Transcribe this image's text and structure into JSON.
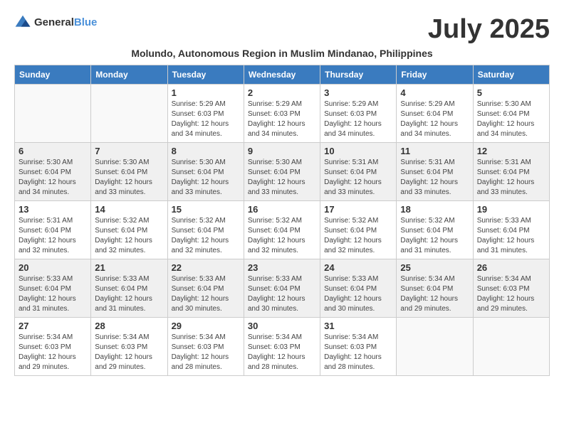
{
  "header": {
    "logo_general": "General",
    "logo_blue": "Blue",
    "month_title": "July 2025",
    "subtitle": "Molundo, Autonomous Region in Muslim Mindanao, Philippines"
  },
  "days_of_week": [
    "Sunday",
    "Monday",
    "Tuesday",
    "Wednesday",
    "Thursday",
    "Friday",
    "Saturday"
  ],
  "weeks": [
    {
      "shaded": false,
      "days": [
        {
          "number": "",
          "info": ""
        },
        {
          "number": "",
          "info": ""
        },
        {
          "number": "1",
          "info": "Sunrise: 5:29 AM\nSunset: 6:03 PM\nDaylight: 12 hours and 34 minutes."
        },
        {
          "number": "2",
          "info": "Sunrise: 5:29 AM\nSunset: 6:03 PM\nDaylight: 12 hours and 34 minutes."
        },
        {
          "number": "3",
          "info": "Sunrise: 5:29 AM\nSunset: 6:03 PM\nDaylight: 12 hours and 34 minutes."
        },
        {
          "number": "4",
          "info": "Sunrise: 5:29 AM\nSunset: 6:04 PM\nDaylight: 12 hours and 34 minutes."
        },
        {
          "number": "5",
          "info": "Sunrise: 5:30 AM\nSunset: 6:04 PM\nDaylight: 12 hours and 34 minutes."
        }
      ]
    },
    {
      "shaded": true,
      "days": [
        {
          "number": "6",
          "info": "Sunrise: 5:30 AM\nSunset: 6:04 PM\nDaylight: 12 hours and 34 minutes."
        },
        {
          "number": "7",
          "info": "Sunrise: 5:30 AM\nSunset: 6:04 PM\nDaylight: 12 hours and 33 minutes."
        },
        {
          "number": "8",
          "info": "Sunrise: 5:30 AM\nSunset: 6:04 PM\nDaylight: 12 hours and 33 minutes."
        },
        {
          "number": "9",
          "info": "Sunrise: 5:30 AM\nSunset: 6:04 PM\nDaylight: 12 hours and 33 minutes."
        },
        {
          "number": "10",
          "info": "Sunrise: 5:31 AM\nSunset: 6:04 PM\nDaylight: 12 hours and 33 minutes."
        },
        {
          "number": "11",
          "info": "Sunrise: 5:31 AM\nSunset: 6:04 PM\nDaylight: 12 hours and 33 minutes."
        },
        {
          "number": "12",
          "info": "Sunrise: 5:31 AM\nSunset: 6:04 PM\nDaylight: 12 hours and 33 minutes."
        }
      ]
    },
    {
      "shaded": false,
      "days": [
        {
          "number": "13",
          "info": "Sunrise: 5:31 AM\nSunset: 6:04 PM\nDaylight: 12 hours and 32 minutes."
        },
        {
          "number": "14",
          "info": "Sunrise: 5:32 AM\nSunset: 6:04 PM\nDaylight: 12 hours and 32 minutes."
        },
        {
          "number": "15",
          "info": "Sunrise: 5:32 AM\nSunset: 6:04 PM\nDaylight: 12 hours and 32 minutes."
        },
        {
          "number": "16",
          "info": "Sunrise: 5:32 AM\nSunset: 6:04 PM\nDaylight: 12 hours and 32 minutes."
        },
        {
          "number": "17",
          "info": "Sunrise: 5:32 AM\nSunset: 6:04 PM\nDaylight: 12 hours and 32 minutes."
        },
        {
          "number": "18",
          "info": "Sunrise: 5:32 AM\nSunset: 6:04 PM\nDaylight: 12 hours and 31 minutes."
        },
        {
          "number": "19",
          "info": "Sunrise: 5:33 AM\nSunset: 6:04 PM\nDaylight: 12 hours and 31 minutes."
        }
      ]
    },
    {
      "shaded": true,
      "days": [
        {
          "number": "20",
          "info": "Sunrise: 5:33 AM\nSunset: 6:04 PM\nDaylight: 12 hours and 31 minutes."
        },
        {
          "number": "21",
          "info": "Sunrise: 5:33 AM\nSunset: 6:04 PM\nDaylight: 12 hours and 31 minutes."
        },
        {
          "number": "22",
          "info": "Sunrise: 5:33 AM\nSunset: 6:04 PM\nDaylight: 12 hours and 30 minutes."
        },
        {
          "number": "23",
          "info": "Sunrise: 5:33 AM\nSunset: 6:04 PM\nDaylight: 12 hours and 30 minutes."
        },
        {
          "number": "24",
          "info": "Sunrise: 5:33 AM\nSunset: 6:04 PM\nDaylight: 12 hours and 30 minutes."
        },
        {
          "number": "25",
          "info": "Sunrise: 5:34 AM\nSunset: 6:04 PM\nDaylight: 12 hours and 29 minutes."
        },
        {
          "number": "26",
          "info": "Sunrise: 5:34 AM\nSunset: 6:03 PM\nDaylight: 12 hours and 29 minutes."
        }
      ]
    },
    {
      "shaded": false,
      "days": [
        {
          "number": "27",
          "info": "Sunrise: 5:34 AM\nSunset: 6:03 PM\nDaylight: 12 hours and 29 minutes."
        },
        {
          "number": "28",
          "info": "Sunrise: 5:34 AM\nSunset: 6:03 PM\nDaylight: 12 hours and 29 minutes."
        },
        {
          "number": "29",
          "info": "Sunrise: 5:34 AM\nSunset: 6:03 PM\nDaylight: 12 hours and 28 minutes."
        },
        {
          "number": "30",
          "info": "Sunrise: 5:34 AM\nSunset: 6:03 PM\nDaylight: 12 hours and 28 minutes."
        },
        {
          "number": "31",
          "info": "Sunrise: 5:34 AM\nSunset: 6:03 PM\nDaylight: 12 hours and 28 minutes."
        },
        {
          "number": "",
          "info": ""
        },
        {
          "number": "",
          "info": ""
        }
      ]
    }
  ]
}
